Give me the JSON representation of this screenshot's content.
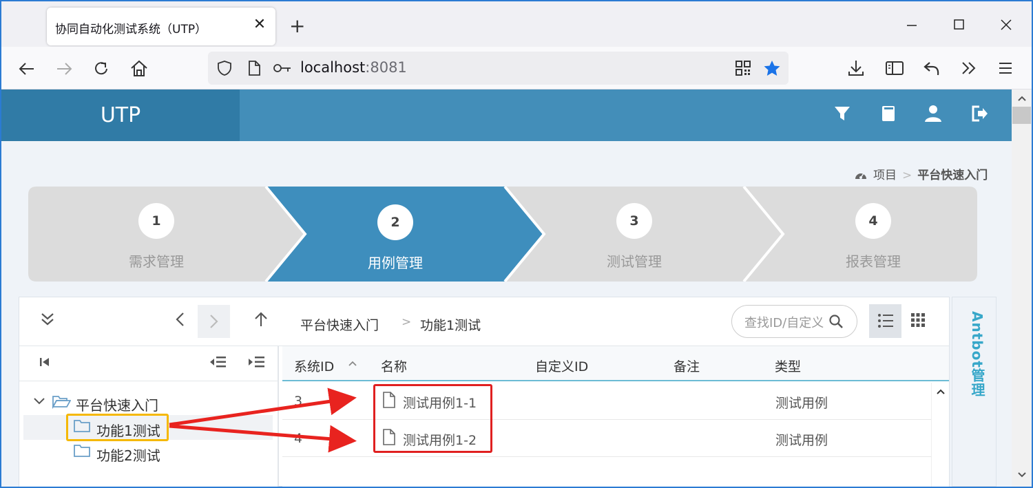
{
  "browser": {
    "tab_title": "协同自动化测试系统（UTP）",
    "tab_close": "✕",
    "new_tab": "+",
    "url_host": "localhost",
    "url_port": ":8081"
  },
  "app": {
    "brand": "UTP"
  },
  "breadcrumb": {
    "root": "项目",
    "sep": ">",
    "current": "平台快速入门"
  },
  "wizard": {
    "steps": [
      {
        "num": "1",
        "label": "需求管理"
      },
      {
        "num": "2",
        "label": "用例管理"
      },
      {
        "num": "3",
        "label": "测试管理"
      },
      {
        "num": "4",
        "label": "报表管理"
      }
    ],
    "active_index": 1
  },
  "toolbar": {
    "path": [
      "平台快速入门",
      "功能1测试"
    ],
    "path_sep": ">",
    "search_placeholder": "查找ID/自定义"
  },
  "tree": {
    "root": "平台快速入门",
    "children": [
      "功能1测试",
      "功能2测试"
    ],
    "selected": "功能1测试"
  },
  "grid": {
    "columns": [
      "系统ID",
      "名称",
      "自定义ID",
      "备注",
      "类型"
    ],
    "rows": [
      {
        "id": "3",
        "name": "测试用例1-1",
        "custom_id": "",
        "remark": "",
        "type": "测试用例"
      },
      {
        "id": "4",
        "name": "测试用例1-2",
        "custom_id": "",
        "remark": "",
        "type": "测试用例"
      }
    ]
  },
  "antbot": {
    "label": "Antbot管理"
  },
  "colors": {
    "header": "#438eb9",
    "brand_bg": "#307ba6",
    "wizard_active": "#3e8ebd",
    "wizard_inactive": "#dcdcdc",
    "highlight_red": "#e02020",
    "highlight_yellow": "#f5b800"
  }
}
